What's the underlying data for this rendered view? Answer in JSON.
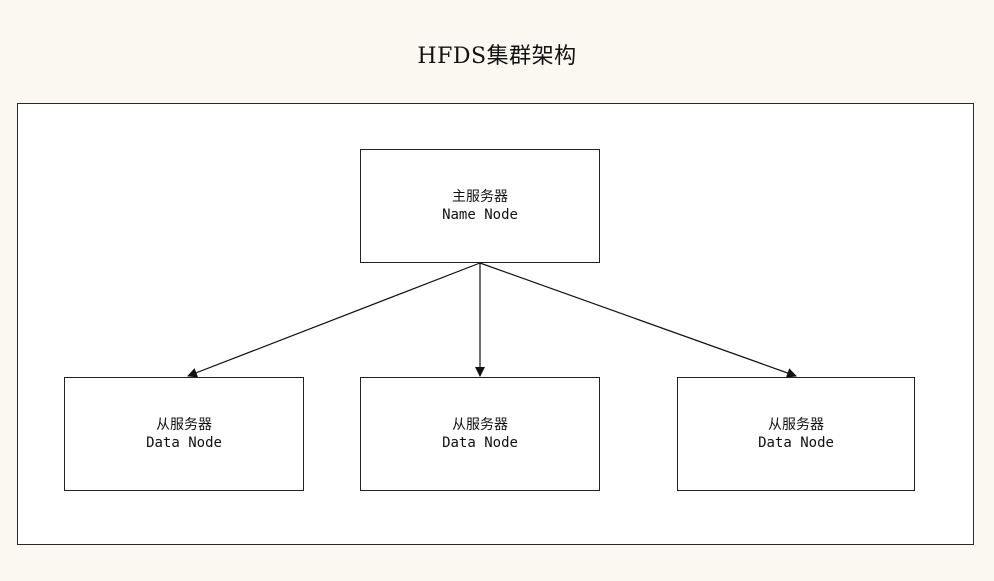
{
  "diagram": {
    "title": "HFDS集群架构",
    "name_node": {
      "label_cn": "主服务器",
      "label_en": "Name Node"
    },
    "data_nodes": [
      {
        "label_cn": "从服务器",
        "label_en": "Data Node"
      },
      {
        "label_cn": "从服务器",
        "label_en": "Data Node"
      },
      {
        "label_cn": "从服务器",
        "label_en": "Data Node"
      }
    ],
    "edges": [
      {
        "from": "name_node",
        "to": "data_node_1"
      },
      {
        "from": "name_node",
        "to": "data_node_2"
      },
      {
        "from": "name_node",
        "to": "data_node_3"
      }
    ]
  }
}
